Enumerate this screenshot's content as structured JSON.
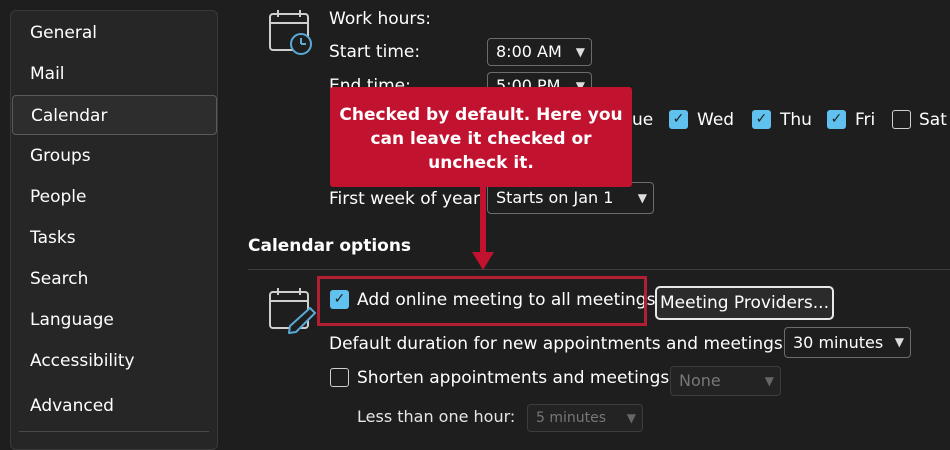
{
  "sidebar": {
    "items": [
      {
        "label": "General",
        "active": false
      },
      {
        "label": "Mail",
        "active": false
      },
      {
        "label": "Calendar",
        "active": true
      },
      {
        "label": "Groups",
        "active": false
      },
      {
        "label": "People",
        "active": false
      },
      {
        "label": "Tasks",
        "active": false
      },
      {
        "label": "Search",
        "active": false
      },
      {
        "label": "Language",
        "active": false
      },
      {
        "label": "Accessibility",
        "active": false
      },
      {
        "label": "Advanced",
        "active": false
      }
    ]
  },
  "work_hours": {
    "title": "Work hours:",
    "start_label": "Start time:",
    "start_value": "8:00 AM",
    "end_label": "End time:",
    "end_value": "5:00 PM",
    "partial_day_label": "ue",
    "days": [
      {
        "label": "Wed",
        "checked": true
      },
      {
        "label": "Thu",
        "checked": true
      },
      {
        "label": "Fri",
        "checked": true
      },
      {
        "label": "Sat",
        "checked": false
      }
    ],
    "first_week_label": "First week of year:",
    "first_week_value": "Starts on Jan 1"
  },
  "calendar_options": {
    "title": "Calendar options",
    "online_meeting_label": "Add online meeting to all meetings",
    "online_meeting_checked": true,
    "providers_button": "Meeting Providers...",
    "duration_label": "Default duration for new appointments and meetings:",
    "duration_value": "30 minutes",
    "shorten_label": "Shorten appointments and meetings:",
    "shorten_checked": false,
    "shorten_value": "None",
    "less_than_label": "Less than one hour:",
    "less_than_value": "5 minutes"
  },
  "callout": {
    "text": "Checked by default. Here you can leave it checked or uncheck it."
  },
  "colors": {
    "accent": "#60c0ee",
    "callout": "#c11230",
    "background": "#1e1e1e"
  },
  "icons": {
    "work_hours": "calendar-clock-icon",
    "calendar_options": "calendar-pencil-icon",
    "dropdown": "chevron-down-icon",
    "check": "checkmark-icon"
  }
}
